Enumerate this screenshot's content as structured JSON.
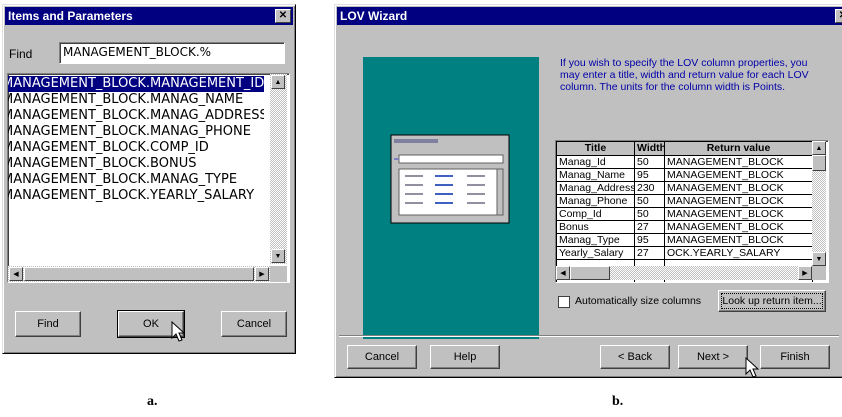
{
  "panel_a": {
    "title": "Items and Parameters",
    "find_label": "Find",
    "find_value": "MANAGEMENT_BLOCK.%",
    "items": [
      "MANAGEMENT_BLOCK.MANAGEMENT_ID",
      "MANAGEMENT_BLOCK.MANAG_NAME",
      "MANAGEMENT_BLOCK.MANAG_ADDRESS",
      "MANAGEMENT_BLOCK.MANAG_PHONE",
      "MANAGEMENT_BLOCK.COMP_ID",
      "MANAGEMENT_BLOCK.BONUS",
      "MANAGEMENT_BLOCK.MANAG_TYPE",
      "MANAGEMENT_BLOCK.YEARLY_SALARY"
    ],
    "selected_index": 0,
    "buttons": {
      "find": "Find",
      "ok": "OK",
      "cancel": "Cancel"
    },
    "caption": "a."
  },
  "panel_b": {
    "title": "LOV Wizard",
    "instructions": "If you wish to specify the LOV column properties, you may enter a title, width and return value for each LOV column. The units for the column width is Points.",
    "columns": [
      "Title",
      "Width",
      "Return value"
    ],
    "rows": [
      [
        "Manag_Id",
        "50",
        "MANAGEMENT_BLOCK"
      ],
      [
        "Manag_Name",
        "95",
        "MANAGEMENT_BLOCK"
      ],
      [
        "Manag_Address",
        "230",
        "MANAGEMENT_BLOCK"
      ],
      [
        "Manag_Phone",
        "50",
        "MANAGEMENT_BLOCK"
      ],
      [
        "Comp_Id",
        "50",
        "MANAGEMENT_BLOCK"
      ],
      [
        "Bonus",
        "27",
        "MANAGEMENT_BLOCK"
      ],
      [
        "Manag_Type",
        "95",
        "MANAGEMENT_BLOCK"
      ],
      [
        "Yearly_Salary",
        "27",
        "OCK.YEARLY_SALARY"
      ]
    ],
    "auto_size_label": "Automatically size columns",
    "auto_size_checked": false,
    "lookup_button": "Look up return item...",
    "buttons": {
      "cancel": "Cancel",
      "help": "Help",
      "back": "< Back",
      "next": "Next >",
      "finish": "Finish"
    },
    "caption": "b."
  },
  "colors": {
    "title_bar": "#000080",
    "selection": "#000080",
    "illustration_bg": "#008080",
    "instruction_text": "#0000a8"
  }
}
